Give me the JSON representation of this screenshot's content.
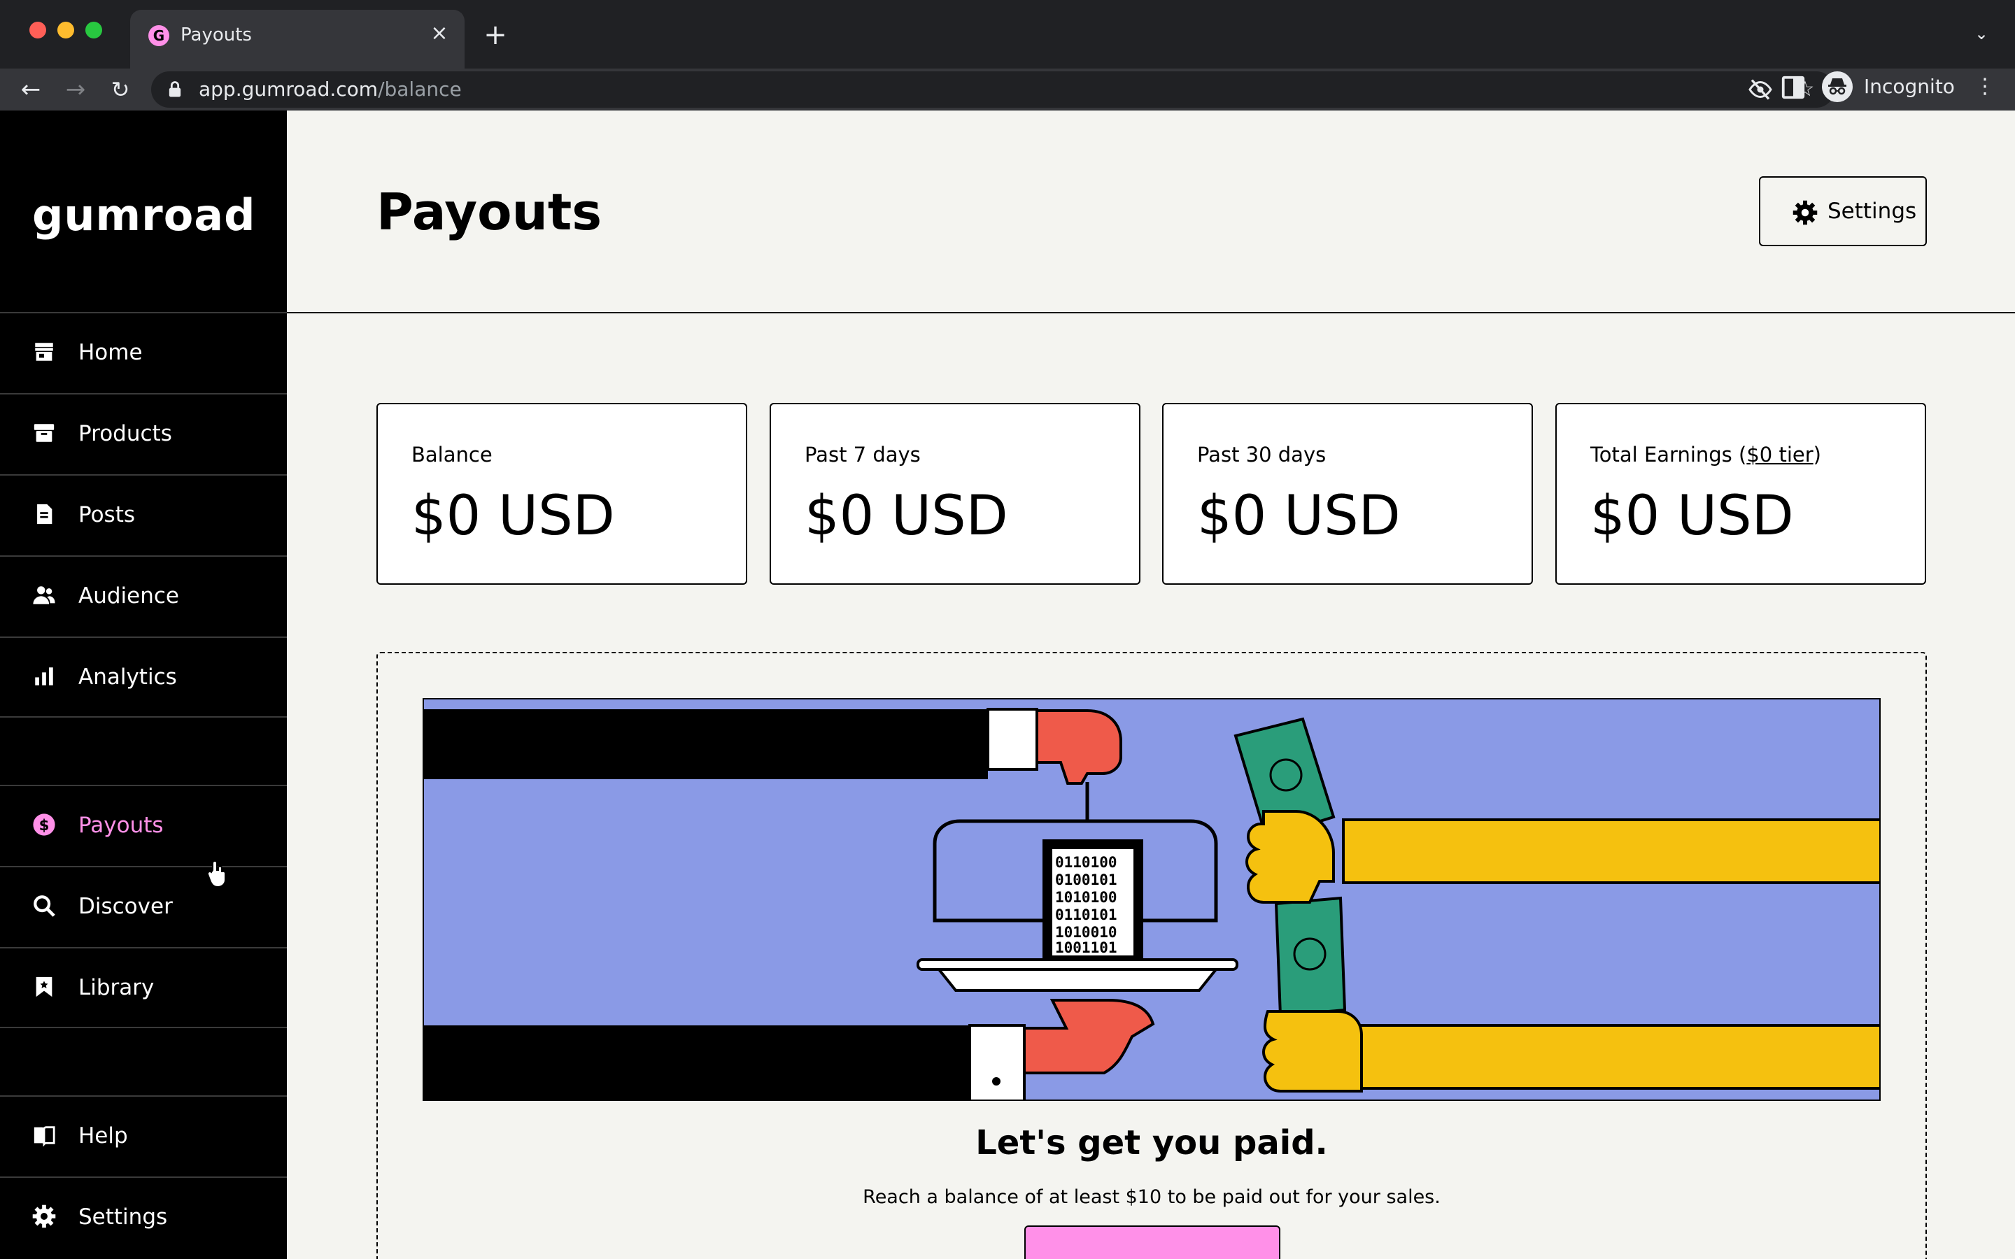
{
  "browser": {
    "tab_title": "Payouts",
    "tab_favicon_letter": "G",
    "url_host": "app.gumroad.com",
    "url_path": "/balance",
    "profile_label": "Incognito"
  },
  "sidebar": {
    "logo": "Gumroad",
    "items": [
      {
        "label": "Home",
        "icon": "shop-icon"
      },
      {
        "label": "Products",
        "icon": "archive-icon"
      },
      {
        "label": "Posts",
        "icon": "document-icon"
      },
      {
        "label": "Audience",
        "icon": "people-icon"
      },
      {
        "label": "Analytics",
        "icon": "bar-chart-icon"
      },
      {
        "label": "Payouts",
        "icon": "dollar-circle-icon",
        "active": true
      },
      {
        "label": "Discover",
        "icon": "search-icon"
      },
      {
        "label": "Library",
        "icon": "bookmark-icon"
      },
      {
        "label": "Help",
        "icon": "book-icon"
      },
      {
        "label": "Settings",
        "icon": "gear-icon"
      }
    ]
  },
  "header": {
    "title": "Payouts",
    "settings_label": "Settings"
  },
  "stats": [
    {
      "label": "Balance",
      "value": "$0 USD"
    },
    {
      "label": "Past 7 days",
      "value": "$0 USD"
    },
    {
      "label": "Past 30 days",
      "value": "$0 USD"
    },
    {
      "label": "Total Earnings",
      "tier_link": "$0 tier",
      "value": "$0 USD"
    }
  ],
  "empty_state": {
    "title": "Let's get you paid.",
    "text": "Reach a balance of at least $10 to be paid out for your sales."
  },
  "colors": {
    "accent": "#ff90e8",
    "background": "#f4f4f0",
    "sidebar": "#000000",
    "illustration_bg": "#8a9ae6"
  }
}
